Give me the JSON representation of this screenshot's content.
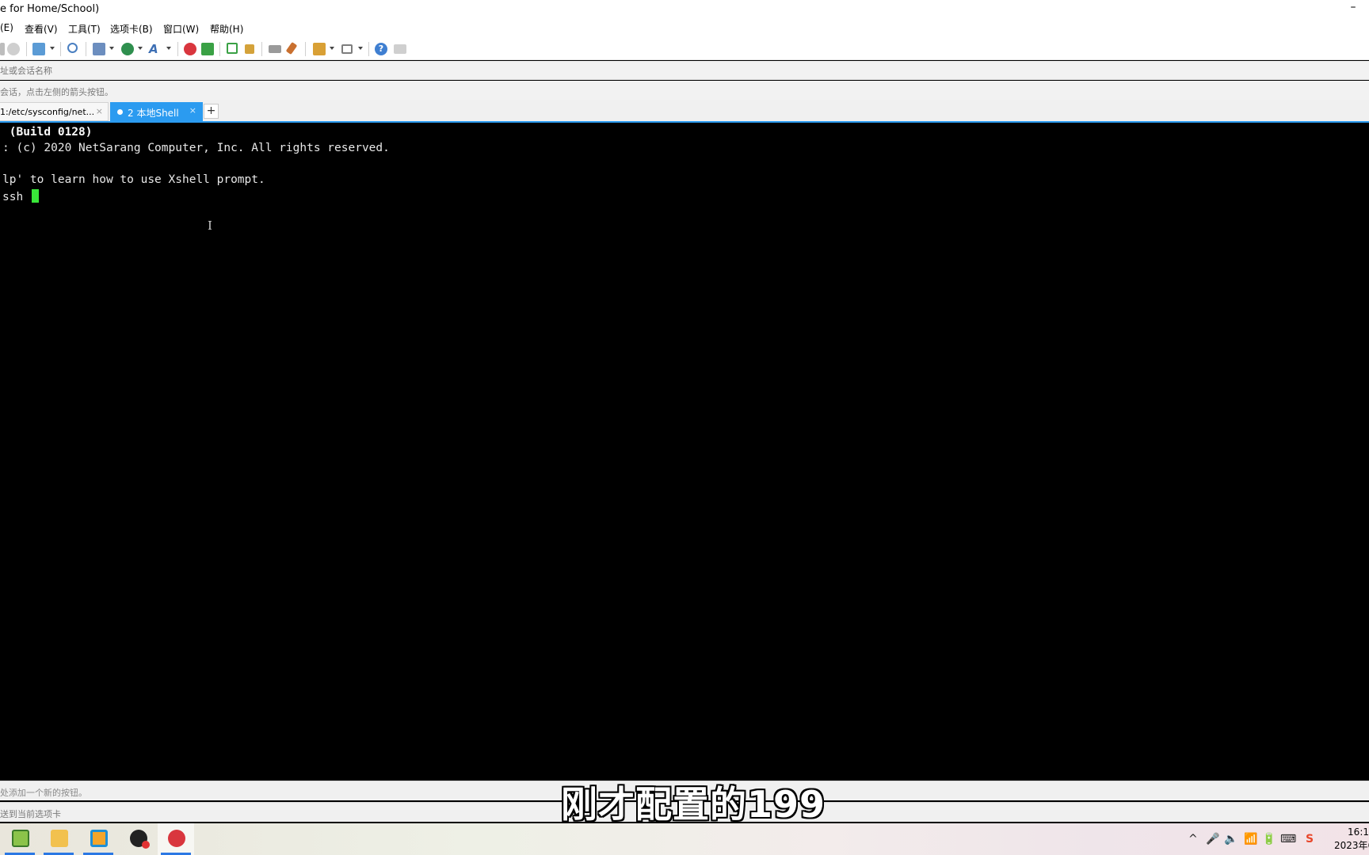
{
  "window": {
    "title": "e for Home/School)",
    "minimize_glyph": "–"
  },
  "menu": [
    "(E)",
    "查看(V)",
    "工具(T)",
    "选项卡(B)",
    "窗口(W)",
    "帮助(H)"
  ],
  "toolbar_icons": [
    "link-icon",
    "new-tab-icon",
    "find-icon",
    "transfer-icon",
    "globe-icon",
    "font-icon",
    "xftp-icon",
    "green-icon",
    "fullscreen-icon",
    "lock-icon",
    "keyboard-icon",
    "highlight-icon",
    "script-icon",
    "layout-icon",
    "help-icon",
    "chat-icon"
  ],
  "address": {
    "placeholder": "址或会话名称"
  },
  "hint": "会话，点击左侧的箭头按钮。",
  "tabs": [
    {
      "label": "1:/etc/sysconfig/net...",
      "close": "×"
    },
    {
      "label": "2 本地Shell",
      "close": "×"
    }
  ],
  "tab_add": "+",
  "terminal": {
    "lines": [
      " (Build 0128)",
      ": (c) 2020 NetSarang Computer, Inc. All rights reserved.",
      "",
      "lp' to learn how to use Xshell prompt.",
      "ssh "
    ]
  },
  "status1": "处添加一个新的按钮。",
  "status2": "送到当前选项卡",
  "subtitle": "刚才配置的199",
  "taskbar": {
    "apps": [
      "notepad-app",
      "explorer-app",
      "vmware-app",
      "obs-app",
      "xshell-app"
    ],
    "tray": [
      "^",
      "🎤",
      "🔈",
      "📶",
      "🔋",
      "⌨",
      "S"
    ],
    "clock_time": "16:1",
    "clock_date": "2023年6"
  },
  "colors": {
    "accent": "#2b9bf0",
    "cursor": "#39e639",
    "terminal_bg": "#000000"
  }
}
